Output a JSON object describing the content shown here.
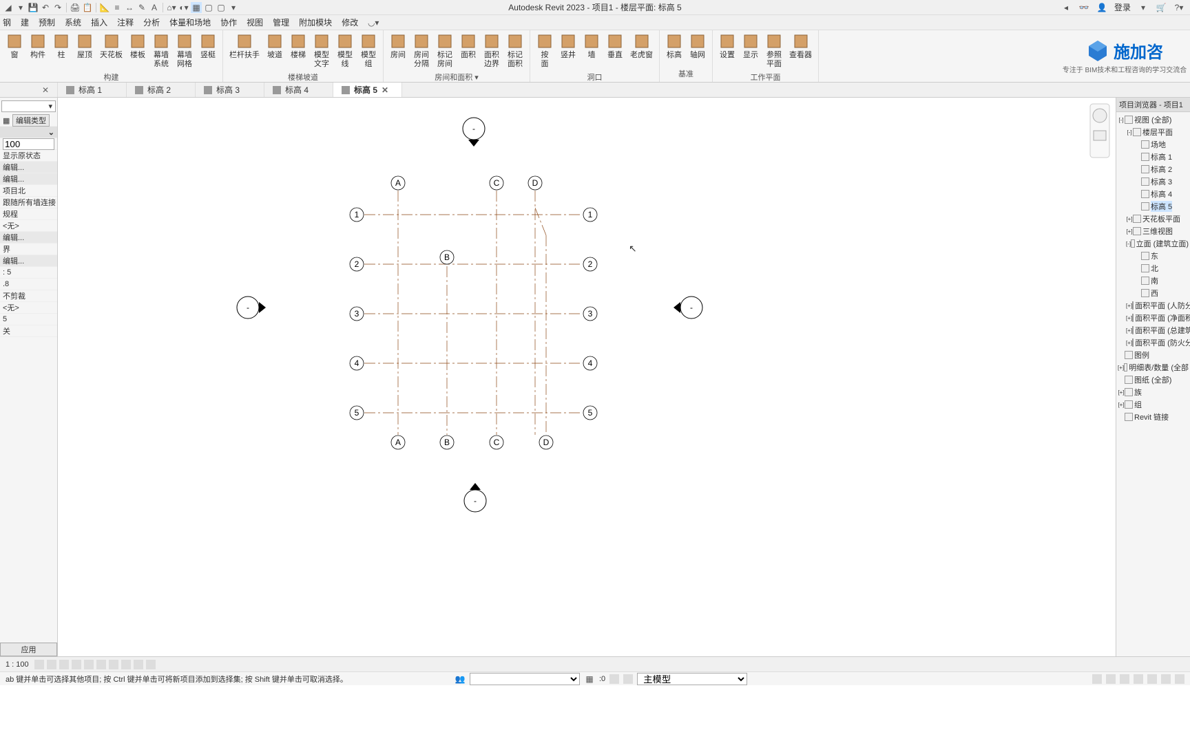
{
  "titlebar": {
    "title": "Autodesk Revit 2023 - 项目1 - 楼层平面: 标高 5",
    "login": "登录"
  },
  "menu": [
    "钢",
    "建",
    "预制",
    "系统",
    "插入",
    "注释",
    "分析",
    "体量和场地",
    "协作",
    "视图",
    "管理",
    "附加模块",
    "修改"
  ],
  "ribbon": {
    "groups": [
      {
        "label": "构建",
        "buttons": [
          "窗",
          "构件",
          "柱",
          "屋顶",
          "天花板",
          "楼板",
          "幕墙\n系统",
          "幕墙\n网格",
          "竖梃"
        ]
      },
      {
        "label": "楼梯坡道",
        "buttons": [
          "栏杆扶手",
          "坡道",
          "楼梯",
          "模型\n文字",
          "模型\n线",
          "模型\n组"
        ]
      },
      {
        "label": "房间和面积 ▾",
        "buttons": [
          "房间",
          "房间\n分隔",
          "标记\n房间",
          "面积",
          "面积\n边界",
          "标记\n面积"
        ]
      },
      {
        "label": "洞口",
        "buttons": [
          "按\n面",
          "竖井",
          "墙",
          "垂直",
          "老虎窗"
        ]
      },
      {
        "label": "基准",
        "buttons": [
          "标高",
          "轴网"
        ]
      },
      {
        "label": "工作平面",
        "buttons": [
          "设置",
          "显示",
          "参照\n平面",
          "查看器"
        ]
      }
    ]
  },
  "logo": {
    "text": "施加咨",
    "subtitle": "专注于 BIM技术和工程咨询的学习交流合"
  },
  "tabs": [
    {
      "label": "标高 1",
      "active": false
    },
    {
      "label": "标高 2",
      "active": false
    },
    {
      "label": "标高 3",
      "active": false
    },
    {
      "label": "标高 4",
      "active": false
    },
    {
      "label": "标高 5",
      "active": true
    }
  ],
  "left_panel": {
    "edit_type": "编辑类型",
    "scale_value": "100",
    "rows": [
      "显示原状态",
      "编辑...",
      "编辑...",
      "项目北",
      "跟随所有墙连接",
      "规程",
      "<无>",
      "编辑...",
      "界",
      "编辑...",
      ": 5",
      ".8",
      "不剪裁",
      "<无>",
      "5",
      "关"
    ],
    "apply": "应用"
  },
  "canvas": {
    "grids_h": [
      "1",
      "2",
      "3",
      "4",
      "5"
    ],
    "grids_v_top": [
      "A",
      "C",
      "D"
    ],
    "grids_v_bottom": [
      "A",
      "B",
      "C",
      "D"
    ],
    "grid_b_mid": "B"
  },
  "browser": {
    "title": "项目浏览器 - 项目1",
    "tree": [
      {
        "label": "视图 (全部)",
        "level": 0,
        "expand": "-"
      },
      {
        "label": "楼层平面",
        "level": 1,
        "expand": "-"
      },
      {
        "label": "场地",
        "level": 2
      },
      {
        "label": "标高 1",
        "level": 2
      },
      {
        "label": "标高 2",
        "level": 2
      },
      {
        "label": "标高 3",
        "level": 2
      },
      {
        "label": "标高 4",
        "level": 2
      },
      {
        "label": "标高 5",
        "level": 2,
        "selected": true
      },
      {
        "label": "天花板平面",
        "level": 1,
        "expand": "+"
      },
      {
        "label": "三维视图",
        "level": 1,
        "expand": "+"
      },
      {
        "label": "立面 (建筑立面)",
        "level": 1,
        "expand": "-"
      },
      {
        "label": "东",
        "level": 2
      },
      {
        "label": "北",
        "level": 2
      },
      {
        "label": "南",
        "level": 2
      },
      {
        "label": "西",
        "level": 2
      },
      {
        "label": "面积平面 (人防分",
        "level": 1,
        "expand": "+"
      },
      {
        "label": "面积平面 (净面积",
        "level": 1,
        "expand": "+"
      },
      {
        "label": "面积平面 (总建筑",
        "level": 1,
        "expand": "+"
      },
      {
        "label": "面积平面 (防火分",
        "level": 1,
        "expand": "+"
      },
      {
        "label": "图例",
        "level": 0
      },
      {
        "label": "明细表/数量 (全部",
        "level": 0,
        "expand": "+"
      },
      {
        "label": "图纸 (全部)",
        "level": 0
      },
      {
        "label": "族",
        "level": 0,
        "expand": "+"
      },
      {
        "label": "组",
        "level": 0,
        "expand": "+"
      },
      {
        "label": "Revit 链接",
        "level": 0
      }
    ]
  },
  "status": {
    "scale": "1 : 100",
    "hint": "ab 键并单击可选择其他项目; 按 Ctrl 键并单击可将新项目添加到选择集; 按 Shift 键并单击可取消选择。",
    "sel_count": ":0",
    "model": "主模型"
  }
}
